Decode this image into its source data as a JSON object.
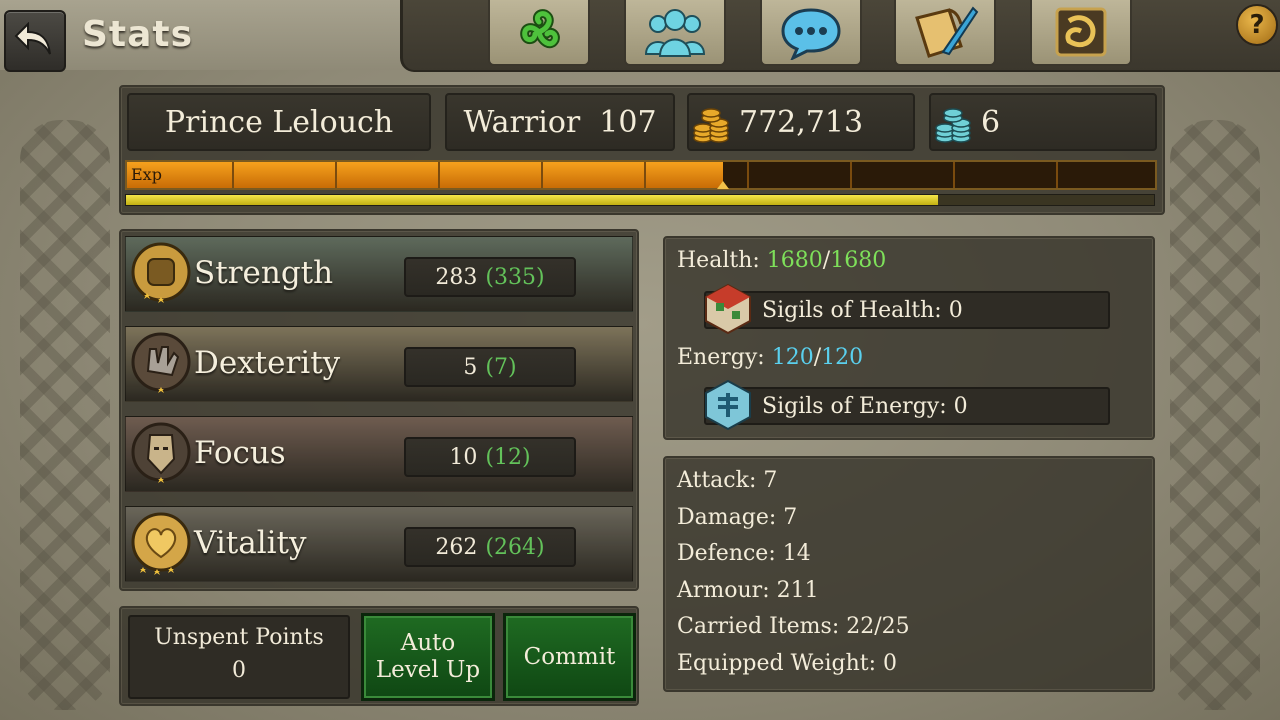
{
  "header": {
    "title": "Stats",
    "nav": [
      {
        "name": "triskele-icon",
        "color": "#3fae32"
      },
      {
        "name": "party-icon",
        "color": "#5cc8d8"
      },
      {
        "name": "chat-bubble-icon",
        "color": "#4fb6e0"
      },
      {
        "name": "quest-scroll-icon",
        "color": "#d9a848"
      },
      {
        "name": "guild-shield-icon",
        "color": "#c99a3c"
      }
    ],
    "help_label": "?"
  },
  "character": {
    "name": "Prince Lelouch",
    "class_level": "Warrior  107",
    "gold": "772,713",
    "gems": "6",
    "exp_label": "Exp",
    "exp_fraction": 0.58,
    "sub_fraction": 0.79
  },
  "stats": [
    {
      "name": "Strength",
      "base": "283",
      "bonus": "(335)",
      "stars": 2,
      "emblem": "strength-gauntlet-icon",
      "bg": "#5e6a5c"
    },
    {
      "name": "Dexterity",
      "base": "5",
      "bonus": "(7)",
      "stars": 1,
      "emblem": "dexterity-gauntlet-icon",
      "bg": "#7d735a"
    },
    {
      "name": "Focus",
      "base": "10",
      "bonus": "(12)",
      "stars": 1,
      "emblem": "focus-mask-icon",
      "bg": "#6f5c50"
    },
    {
      "name": "Vitality",
      "base": "262",
      "bonus": "(264)",
      "stars": 3,
      "emblem": "vitality-heart-icon",
      "bg": "#6a665a"
    }
  ],
  "points": {
    "label": "Unspent Points",
    "value": "0",
    "auto_label_1": "Auto",
    "auto_label_2": "Level Up",
    "commit_label": "Commit"
  },
  "vitals": {
    "health_label": "Health:",
    "health_cur": "1680",
    "health_sep": "/",
    "health_max": "1680",
    "sigils_health": "Sigils of Health: 0",
    "energy_label": "Energy:",
    "energy_cur": "120",
    "energy_sep": "/",
    "energy_max": "120",
    "sigils_energy": "Sigils of Energy: 0",
    "health_color": "#7ee05a",
    "energy_color": "#5ad0ee"
  },
  "details": [
    "Attack: 7",
    "Damage: 7",
    "Defence: 14",
    "Armour: 211",
    "Carried Items: 22/25",
    "Equipped Weight: 0"
  ]
}
